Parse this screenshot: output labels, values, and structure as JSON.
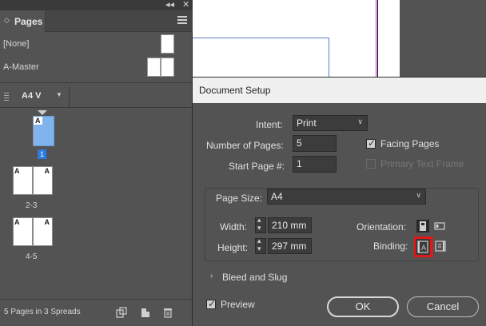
{
  "panel": {
    "tab_label": "Pages",
    "collapse_glyph": "◂◂",
    "close_glyph": "✕",
    "masters": [
      {
        "label": "[None]"
      },
      {
        "label": "A-Master"
      }
    ],
    "master_selector": "A4 V",
    "page_thumbs": [
      {
        "prefix": "A",
        "number": "1"
      }
    ],
    "spreads": [
      {
        "label": "2-3",
        "left_prefix": "A",
        "right_prefix": "A"
      },
      {
        "label": "4-5",
        "left_prefix": "A",
        "right_prefix": "A"
      }
    ],
    "status": "5 Pages in 3 Spreads"
  },
  "dialog": {
    "title": "Document Setup",
    "intent_label": "Intent:",
    "intent_value": "Print",
    "num_pages_label": "Number of Pages:",
    "num_pages_value": "5",
    "start_page_label": "Start Page #:",
    "start_page_value": "1",
    "facing_pages_label": "Facing Pages",
    "facing_pages_checked": true,
    "primary_text_frame_label": "Primary Text Frame",
    "primary_text_frame_enabled": false,
    "page_size_label": "Page Size:",
    "page_size_value": "A4",
    "width_label": "Width:",
    "width_value": "210 mm",
    "height_label": "Height:",
    "height_value": "297 mm",
    "orientation_label": "Orientation:",
    "binding_label": "Binding:",
    "bleed_slug_label": "Bleed and Slug",
    "preview_label": "Preview",
    "preview_checked": true,
    "ok_label": "OK",
    "cancel_label": "Cancel"
  },
  "colors": {
    "highlight_border": "#e01818",
    "page_selected": "#7fb4ee",
    "page_number_badge": "#2d7be0"
  }
}
